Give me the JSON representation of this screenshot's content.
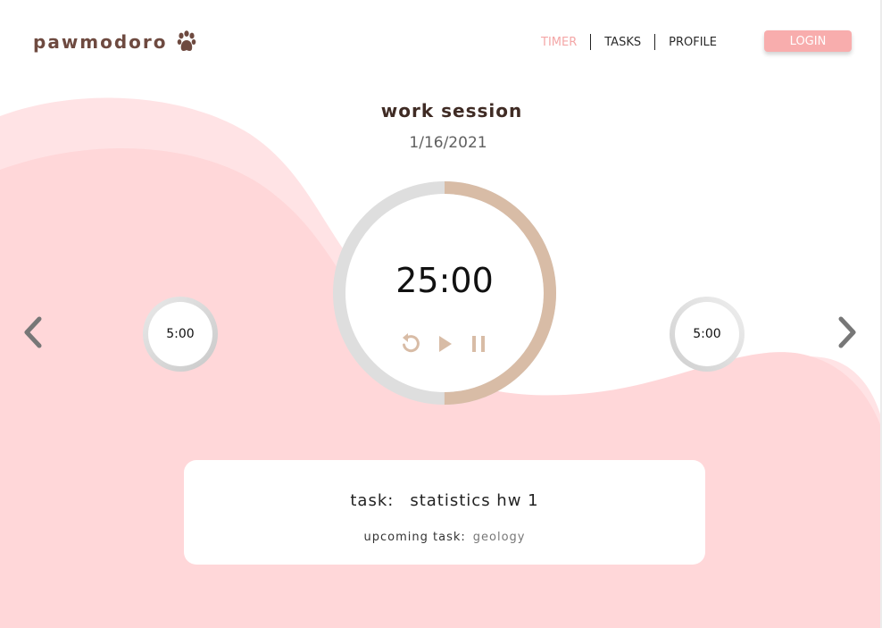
{
  "brand": {
    "name": "pawmodoro",
    "icon": "paw-icon",
    "color": "#6e4a40"
  },
  "nav": {
    "items": [
      {
        "label": "TIMER",
        "active": true
      },
      {
        "label": "TASKS",
        "active": false
      },
      {
        "label": "PROFILE",
        "active": false
      }
    ],
    "login_label": "LOGIN"
  },
  "session": {
    "title": "work session",
    "date": "1/16/2021"
  },
  "timer": {
    "time": "25:00",
    "progress": 0.5,
    "controls": [
      "restart-icon",
      "play-icon",
      "pause-icon"
    ]
  },
  "prev_timer": {
    "time": "5:00"
  },
  "next_timer": {
    "time": "5:00"
  },
  "task": {
    "label": "task:",
    "current": "statistics hw 1",
    "upcoming_label": "upcoming task:",
    "upcoming": "geology"
  },
  "colors": {
    "accent": "#f4a7a7",
    "background_wave": "#ffd7d9",
    "ring_progress": "#d8bca6",
    "ring_track": "#dedede"
  }
}
